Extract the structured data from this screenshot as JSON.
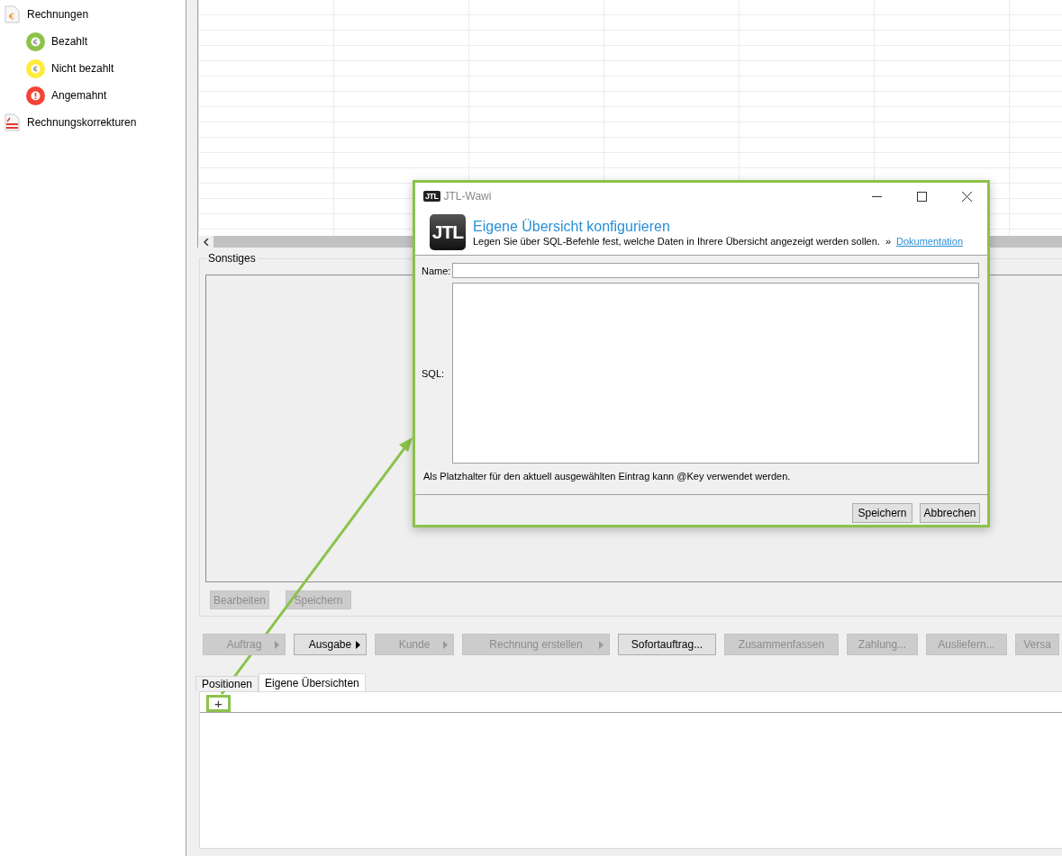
{
  "sidebar": {
    "items": [
      {
        "label": "Rechnungen",
        "kind": "invoice",
        "children": [
          {
            "label": "Bezahlt",
            "kind": "euro",
            "color": "#8bc34a"
          },
          {
            "label": "Nicht bezahlt",
            "kind": "euro",
            "color": "#ffeb3b"
          },
          {
            "label": "Angemahnt",
            "kind": "alert",
            "color": "#f44336"
          }
        ]
      },
      {
        "label": "Rechnungskorrekturen",
        "kind": "correction"
      }
    ]
  },
  "other_group": {
    "title": "Sonstiges",
    "buttons": [
      {
        "label": "Bearbeiten",
        "disabled": true
      },
      {
        "label": "Speichern",
        "disabled": true
      }
    ]
  },
  "toolbar": [
    {
      "label": "Auftrag",
      "disabled": true,
      "dropdown": true
    },
    {
      "label": "Ausgabe",
      "disabled": false,
      "dropdown": true
    },
    {
      "label": "Kunde",
      "disabled": true,
      "dropdown": true
    },
    {
      "label": "Rechnung erstellen",
      "disabled": true,
      "dropdown": true
    },
    {
      "label": "Sofortauftrag...",
      "disabled": false,
      "dropdown": false
    },
    {
      "label": "Zusammenfassen",
      "disabled": true,
      "dropdown": false
    },
    {
      "label": "Zahlung...",
      "disabled": true,
      "dropdown": false
    },
    {
      "label": "Ausliefern...",
      "disabled": true,
      "dropdown": false
    },
    {
      "label": "Versa",
      "disabled": true,
      "dropdown": false
    }
  ],
  "tabs": [
    {
      "label": "Positionen",
      "selected": false
    },
    {
      "label": "Eigene Übersichten",
      "selected": true
    }
  ],
  "add_button": {
    "label": "+",
    "highlighted": true
  },
  "dialog": {
    "title": "JTL-Wawi",
    "title_logo": "JTL",
    "header_logo": "JTL",
    "heading": "Eigene Übersicht konfigurieren",
    "subtitle": "Legen Sie über SQL-Befehle fest, welche Daten in Ihrere Übersicht angezeigt werden sollen.",
    "link_marker": "»",
    "link": "Dokumentation",
    "name_label": "Name:",
    "sql_label": "SQL:",
    "hint": "Als Platzhalter für den aktuell ausgewählten Eintrag kann @Key verwendet werden.",
    "buttons": [
      "Speichern",
      "Abbrechen"
    ]
  }
}
